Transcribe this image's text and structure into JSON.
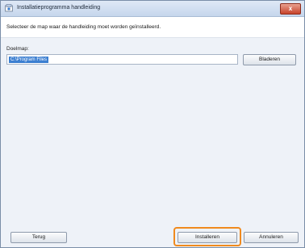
{
  "window": {
    "title": "Installatieprogramma handleiding",
    "close_label": "x"
  },
  "header": {
    "instruction": "Selecteer de map waar de handleiding moet worden geïnstalleerd."
  },
  "path": {
    "label": "Doelmap:",
    "value": "C:\\Program Files"
  },
  "buttons": {
    "browse": "Bladeren",
    "back": "Terug",
    "install": "Installeren",
    "cancel": "Annuleren"
  },
  "colors": {
    "highlight": "#f08a1e",
    "selection": "#3c7fd1"
  }
}
